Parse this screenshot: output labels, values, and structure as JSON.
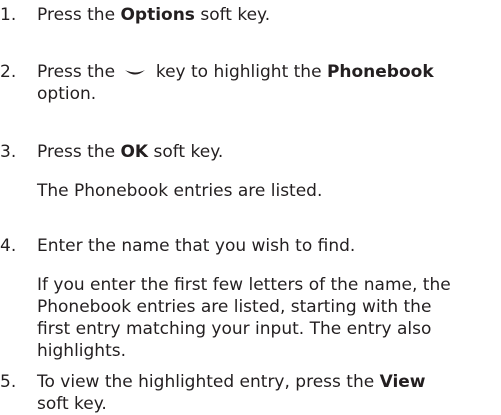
{
  "steps": [
    {
      "number": "1.",
      "before": "Press the ",
      "bold": "Options",
      "after": " soft key."
    },
    {
      "number": "2.",
      "before": "Press the ",
      "icon": "down-key-icon",
      "middle": " key to highlight the ",
      "bold": "Phonebook",
      "line2": "option."
    },
    {
      "number": "3.",
      "before": "Press the ",
      "bold": "OK",
      "after": " soft key.",
      "note": "The Phonebook entries are listed."
    },
    {
      "number": "4.",
      "text": "Enter the name that you wish to find.",
      "note_lines": [
        "If you enter the first few letters of the name, the",
        "Phonebook entries are listed, starting with the",
        "first entry matching your input. The entry also",
        "highlights."
      ]
    },
    {
      "number": "5.",
      "before": "To view the highlighted entry, press the ",
      "bold": "View",
      "line2": "soft key."
    }
  ]
}
